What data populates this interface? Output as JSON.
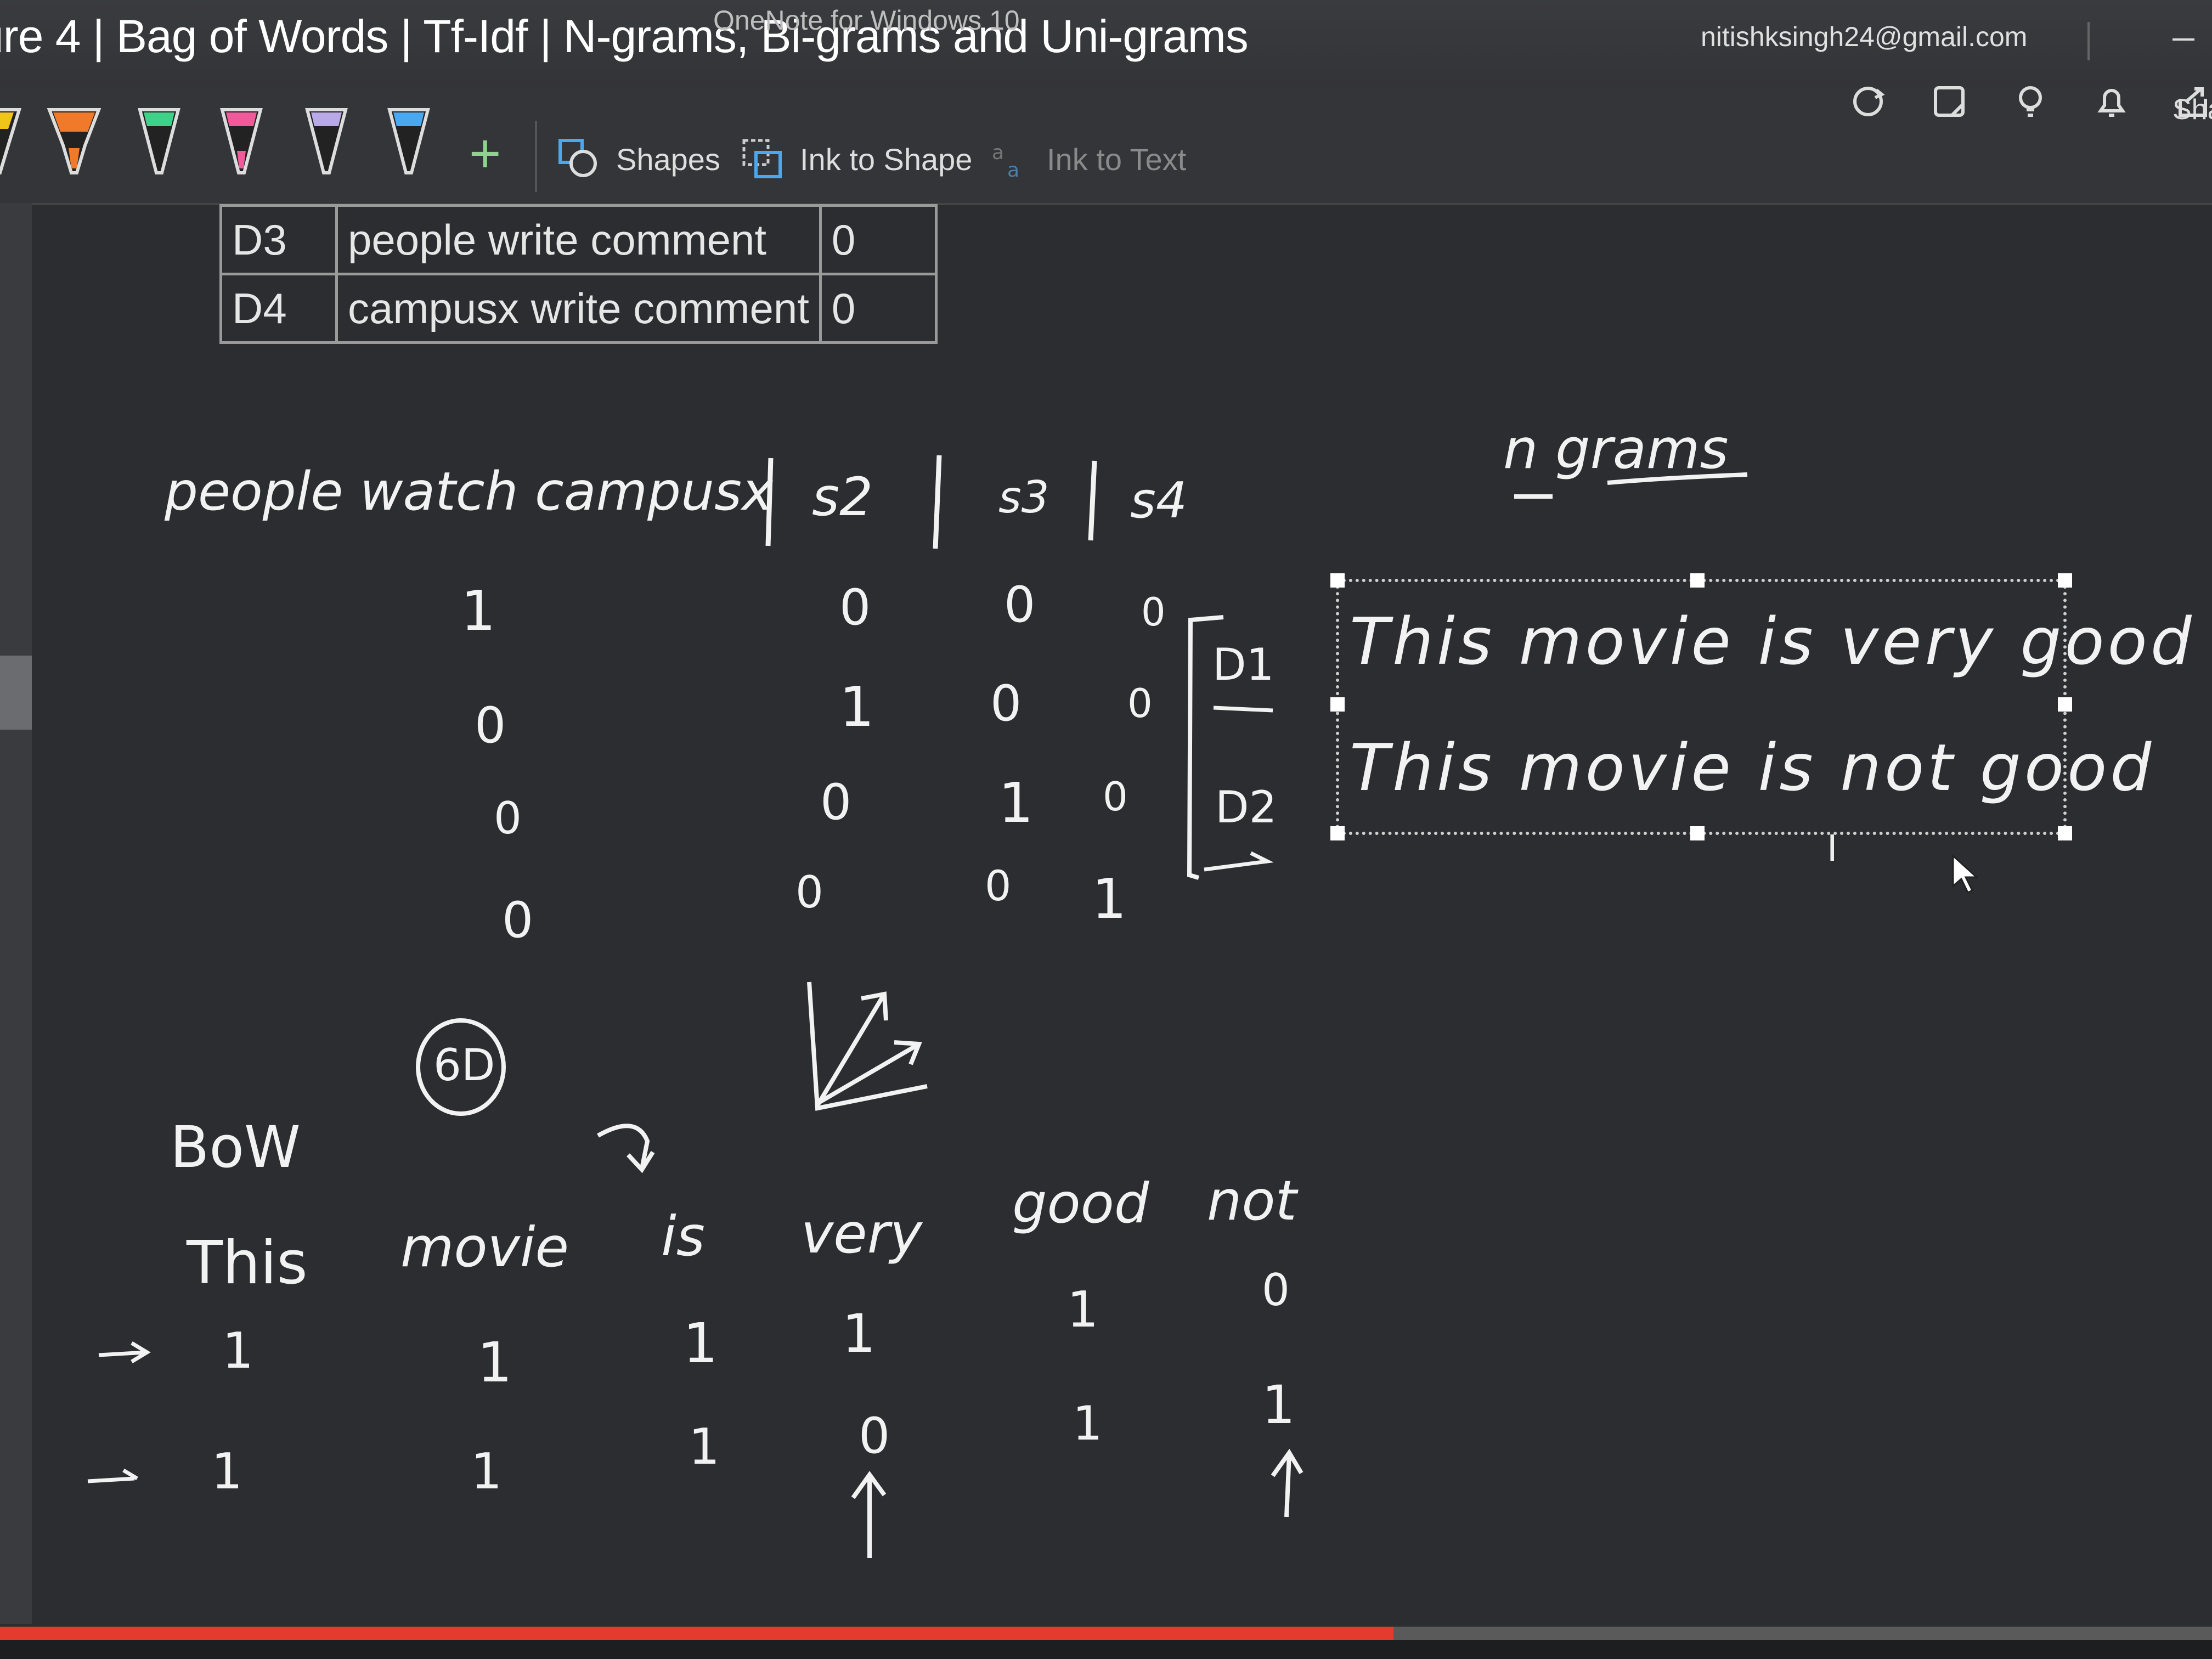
{
  "window": {
    "app_name": "OneNote for Windows 10",
    "video_title": "ure 4 | Bag of Words | Tf-Idf | N-grams, Bi-grams and Uni-grams",
    "account": "nitishksingh24@gmail.com"
  },
  "ribbon": {
    "pens": [
      {
        "name": "yellow-pen-icon",
        "color": "#f0c419"
      },
      {
        "name": "orange-highlighter-icon",
        "color": "#f07a2a"
      },
      {
        "name": "green-pen-icon",
        "color": "#3fd08a"
      },
      {
        "name": "pink-pen-icon",
        "color": "#f05a9a"
      },
      {
        "name": "lavender-pen-icon",
        "color": "#b9a9e6"
      },
      {
        "name": "blue-pen-icon",
        "color": "#4aa8f0"
      }
    ],
    "add_pen": "+",
    "shapes_label": "Shapes",
    "ink_to_shape_label": "Ink to Shape",
    "ink_to_text_label": "Ink to Text",
    "share_label": "Sha"
  },
  "table": {
    "rows": [
      {
        "id": "D3",
        "text": "people write comment",
        "value": "0"
      },
      {
        "id": "D4",
        "text": "campusx write comment",
        "value": "0"
      }
    ]
  },
  "ink": {
    "vocab_header": "people watch campusx",
    "col2": "s2",
    "col3": "s3",
    "col4": "s4",
    "ngrams": "n grams",
    "matrix": [
      [
        "1",
        "0",
        "0",
        "0"
      ],
      [
        "0",
        "1",
        "0",
        "0"
      ],
      [
        "0",
        "0",
        "1",
        "0"
      ],
      [
        "0",
        "0",
        "0",
        "1"
      ]
    ],
    "bracket_labels": [
      "D1",
      "D2"
    ],
    "sentence1": "This movie is very good",
    "sentence2": "This movie is not good",
    "circled": "6D",
    "bow_label": "BoW",
    "bow_vocab": [
      "This",
      "movie",
      "is",
      "very",
      "good",
      "not"
    ],
    "bow_row1": [
      "1",
      "1",
      "1",
      "1",
      "1",
      "0"
    ],
    "bow_row2": [
      "1",
      "1",
      "1",
      "0",
      "1",
      "1"
    ]
  },
  "video": {
    "progress": 0.63
  }
}
